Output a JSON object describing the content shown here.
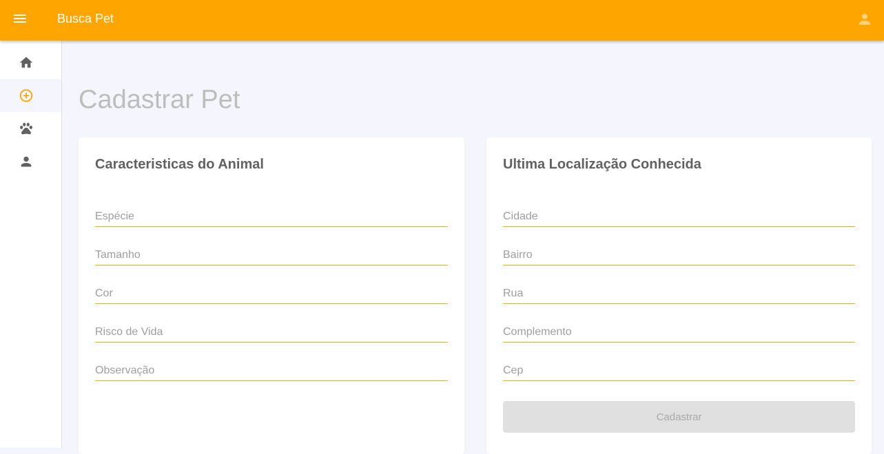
{
  "header": {
    "app_title": "Busca Pet",
    "menu_icon": "menu-icon",
    "account_icon": "account-icon",
    "color": "#ffa500"
  },
  "sidebar": {
    "items": [
      {
        "name": "home",
        "icon": "home-icon",
        "active": false
      },
      {
        "name": "add",
        "icon": "add-circle-icon",
        "active": true
      },
      {
        "name": "pets",
        "icon": "paw-icon",
        "active": false
      },
      {
        "name": "profile",
        "icon": "person-icon",
        "active": false
      }
    ]
  },
  "main": {
    "page_title": "Cadastrar Pet",
    "animal_card": {
      "title": "Caracteristicas do Animal",
      "fields": [
        {
          "placeholder": "Espécie",
          "value": ""
        },
        {
          "placeholder": "Tamanho",
          "value": ""
        },
        {
          "placeholder": "Cor",
          "value": ""
        },
        {
          "placeholder": "Risco de Vida",
          "value": ""
        },
        {
          "placeholder": "Observação",
          "value": ""
        }
      ]
    },
    "location_card": {
      "title": "Ultima Localização Conhecida",
      "fields": [
        {
          "placeholder": "Cidade",
          "value": ""
        },
        {
          "placeholder": "Bairro",
          "value": ""
        },
        {
          "placeholder": "Rua",
          "value": ""
        },
        {
          "placeholder": "Complemento",
          "value": ""
        },
        {
          "placeholder": "Cep",
          "value": ""
        }
      ],
      "submit_label": "Cadastrar",
      "submit_disabled": true
    }
  },
  "colors": {
    "accent": "#ffa500",
    "background": "#f5f6fd",
    "icon_inactive": "#616161"
  }
}
